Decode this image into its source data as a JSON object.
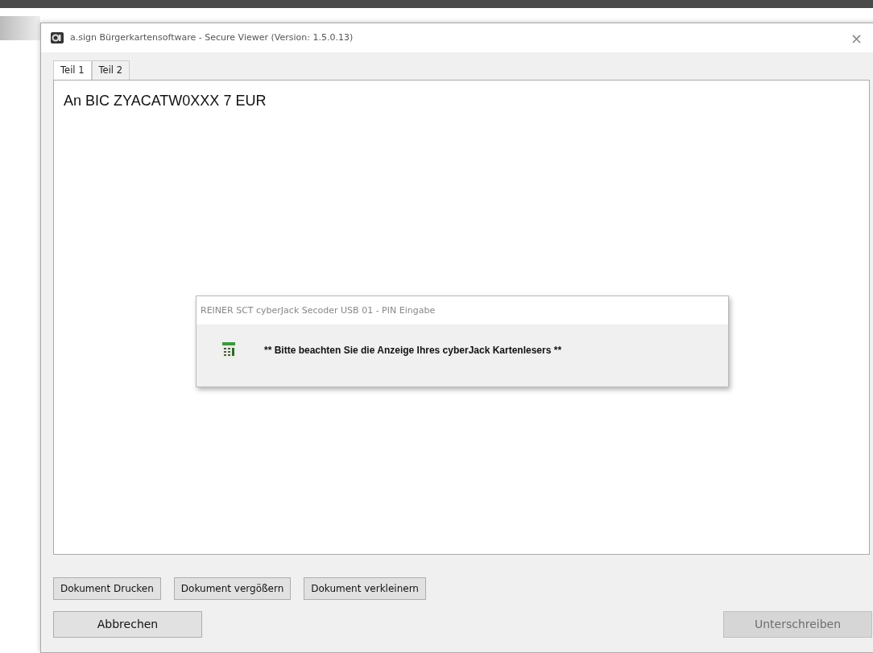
{
  "window": {
    "title": "a.sign Bürgerkartensoftware - Secure Viewer (Version: 1.5.0.13)",
    "close": "×"
  },
  "tabs": [
    {
      "label": "Teil 1",
      "selected": true
    },
    {
      "label": "Teil 2",
      "selected": false
    }
  ],
  "document": {
    "text": "An BIC ZYACATW0XXX 7 EUR"
  },
  "dialog": {
    "title": "REINER SCT cyberJack Secoder USB 01 - PIN Eingabe",
    "message": "** Bitte beachten Sie die Anzeige Ihres cyberJack Kartenlesers **"
  },
  "toolbar": [
    "Dokument Drucken",
    "Dokument vergößern",
    "Dokument verkleinern"
  ],
  "actions": [
    {
      "label": "Abbrechen",
      "disabled": false
    },
    {
      "label": "Unterschreiben",
      "disabled": true
    }
  ]
}
